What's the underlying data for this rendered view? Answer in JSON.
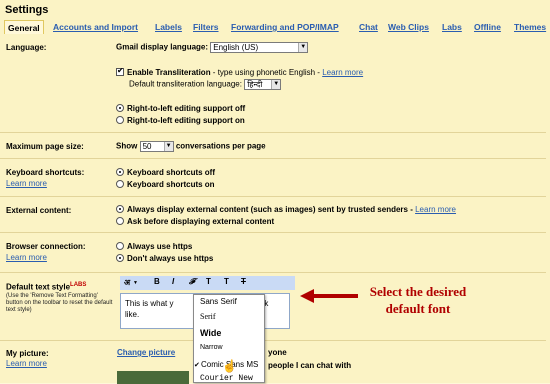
{
  "title": "Settings",
  "tabs": [
    "General",
    "Accounts and Import",
    "Labels",
    "Filters",
    "Forwarding and POP/IMAP",
    "Chat",
    "Web Clips",
    "Labs",
    "Offline",
    "Themes"
  ],
  "language": {
    "label": "Language:",
    "display_label": "Gmail display language:",
    "display_value": "English (US)",
    "transliteration_label": "Enable Transliteration",
    "transliteration_desc": " - type using phonetic English - ",
    "learn_more": "Learn more",
    "default_translit_label": "Default transliteration language:",
    "default_translit_value": "हिन्दी",
    "rtl_off": "Right-to-left editing support off",
    "rtl_on": "Right-to-left editing support on"
  },
  "page_size": {
    "label": "Maximum page size:",
    "show": "Show",
    "value": "50",
    "suffix": "conversations per page"
  },
  "keyboard": {
    "label": "Keyboard shortcuts:",
    "learn_more": "Learn more",
    "off": "Keyboard shortcuts off",
    "on": "Keyboard shortcuts on"
  },
  "external": {
    "label": "External content:",
    "always": "Always display external content (such as images) sent by trusted senders - ",
    "learn_more": "Learn more",
    "ask": "Ask before displaying external content"
  },
  "browser": {
    "label": "Browser connection:",
    "learn_more": "Learn more",
    "always": "Always use https",
    "dont": "Don't always use https"
  },
  "text_style": {
    "label": "Default text style",
    "labs": "LABS",
    "note": "(Use the 'Remove Text Formatting' button on the toolbar to reset the default text style)",
    "sample_line1": "This is what y",
    "sample_line1b": "ook",
    "sample_line2": "like.",
    "toolbar": {
      "font": "अ",
      "bold": "B",
      "italic": "I",
      "script": "𝓕",
      "size": "T",
      "color": "T",
      "clear": "T"
    },
    "fonts": [
      "Sans Serif",
      "Serif",
      "Wide",
      "Narrow",
      "Comic Sans MS",
      "Courier New"
    ],
    "selected_font": "Comic Sans MS"
  },
  "picture": {
    "label": "My picture:",
    "learn_more": "Learn more",
    "change": "Change picture",
    "visible": "yone",
    "visible2": "people I can chat with"
  },
  "annotation": {
    "line1": "Select the desired",
    "line2": "default font",
    "color": "#b00000"
  }
}
